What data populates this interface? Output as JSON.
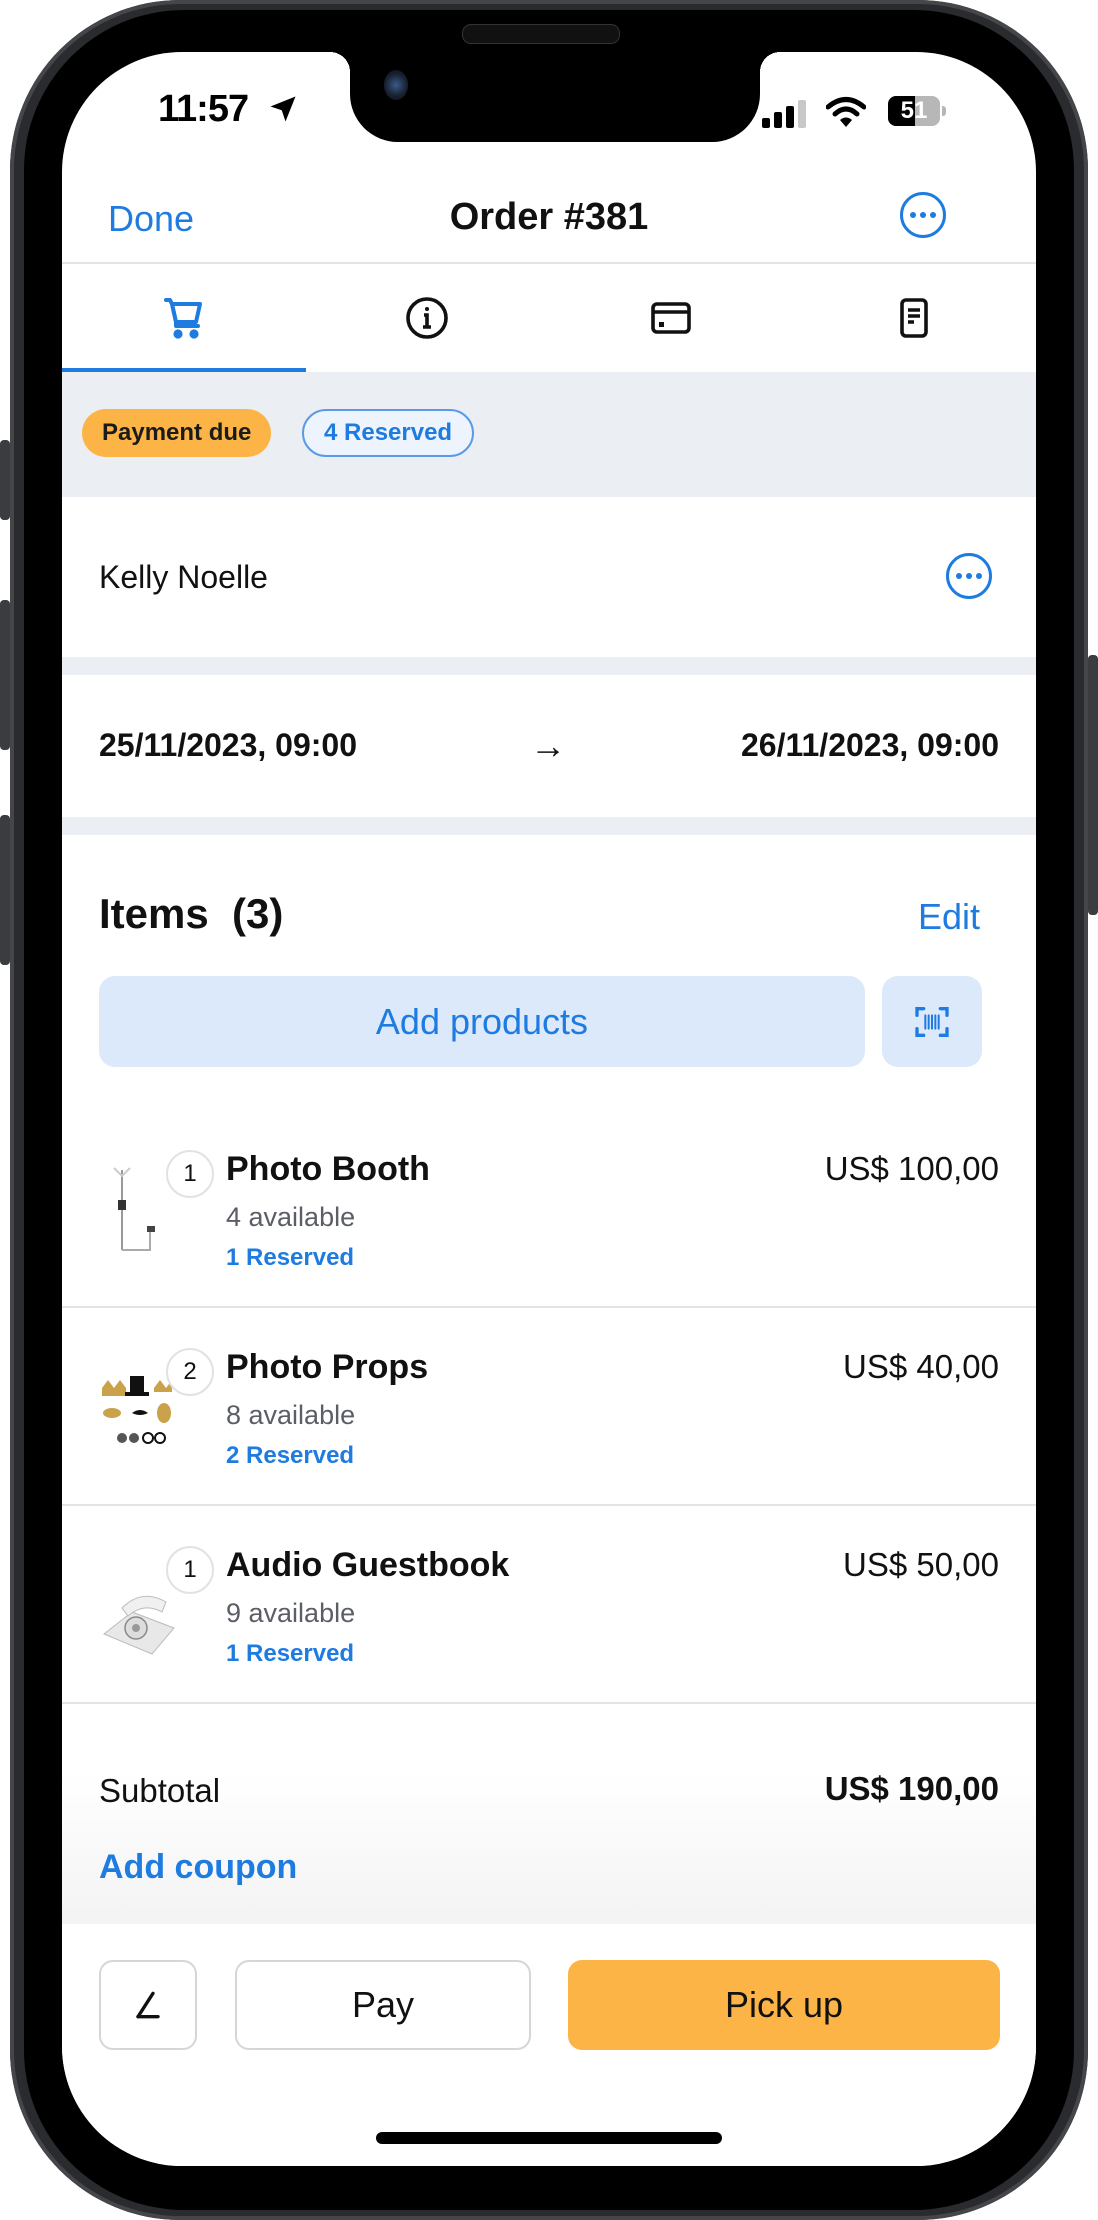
{
  "status_bar": {
    "time": "11:57",
    "battery_level": "51",
    "battery_percent": 51
  },
  "navbar": {
    "done_label": "Done",
    "title": "Order #381",
    "more_icon": "ellipsis-circle-icon"
  },
  "tabs": [
    {
      "icon": "cart-icon",
      "active": true
    },
    {
      "icon": "info-icon",
      "active": false
    },
    {
      "icon": "credit-card-icon",
      "active": false
    },
    {
      "icon": "document-icon",
      "active": false
    }
  ],
  "badges": {
    "payment_status": "Payment due",
    "reserved": "4 Reserved"
  },
  "customer": {
    "name": "Kelly Noelle"
  },
  "period": {
    "start": "25/11/2023, 09:00",
    "arrow": "→",
    "end": "26/11/2023, 09:00"
  },
  "items_section": {
    "title": "Items  (3)",
    "edit_label": "Edit",
    "add_products_label": "Add products",
    "scan_icon": "barcode-scan-icon"
  },
  "items": [
    {
      "qty": "1",
      "name": "Photo Booth",
      "available": "4 available",
      "reserved": "1 Reserved",
      "price": "US$ 100,00",
      "thumb": "photo-booth-image"
    },
    {
      "qty": "2",
      "name": "Photo Props",
      "available": "8 available",
      "reserved": "2 Reserved",
      "price": "US$ 40,00",
      "thumb": "photo-props-image"
    },
    {
      "qty": "1",
      "name": "Audio Guestbook",
      "available": "9 available",
      "reserved": "1 Reserved",
      "price": "US$ 50,00",
      "thumb": "audio-guestbook-image"
    }
  ],
  "summary": {
    "subtotal_label": "Subtotal",
    "subtotal_value": "US$ 190,00",
    "add_coupon_label": "Add coupon"
  },
  "actions": {
    "sign_icon": "signature-icon",
    "pay_label": "Pay",
    "pickup_label": "Pick up"
  },
  "colors": {
    "accent": "#1e7be0",
    "warning": "#fdb446",
    "section_bg": "#ebeef2"
  }
}
